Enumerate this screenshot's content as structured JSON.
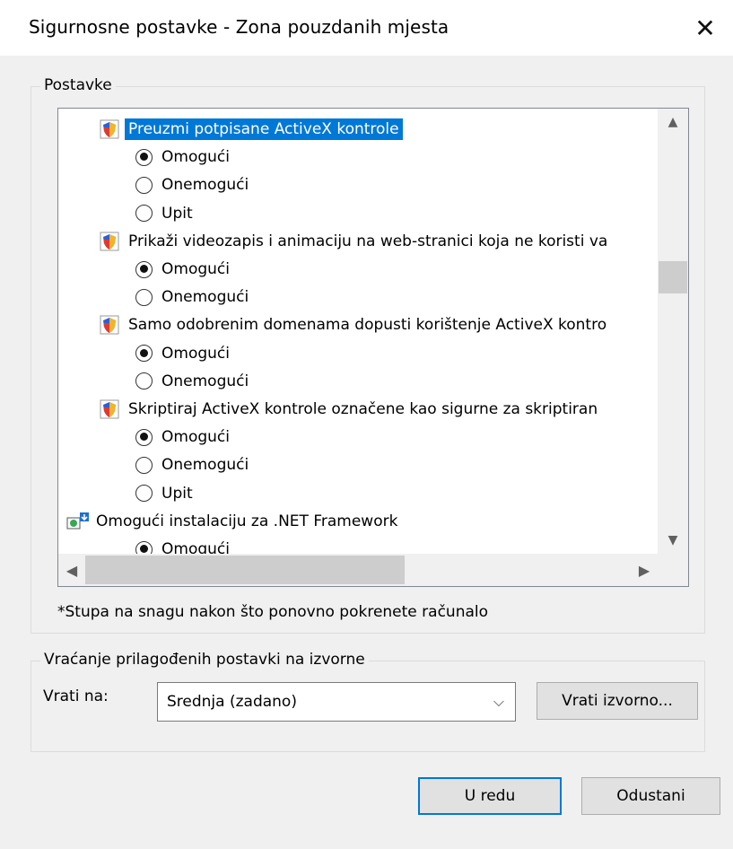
{
  "dialog": {
    "title": "Sigurnosne postavke - Zona pouzdanih mjesta",
    "close_glyph": "✕"
  },
  "settings_group": {
    "legend": "Postavke",
    "items": [
      {
        "type": "category",
        "icon": "shield-icon",
        "label": "Preuzmi potpisane ActiveX kontrole",
        "selected": true
      },
      {
        "type": "option",
        "label": "Omogući",
        "checked": true
      },
      {
        "type": "option",
        "label": "Onemogući",
        "checked": false
      },
      {
        "type": "option",
        "label": "Upit",
        "checked": false
      },
      {
        "type": "category",
        "icon": "shield-icon",
        "label": "Prikaži videozapis i animaciju na web-stranici koja ne koristi va",
        "selected": false
      },
      {
        "type": "option",
        "label": "Omogući",
        "checked": true
      },
      {
        "type": "option",
        "label": "Onemogući",
        "checked": false
      },
      {
        "type": "category",
        "icon": "shield-icon",
        "label": "Samo odobrenim domenama dopusti korištenje ActiveX kontro",
        "selected": false
      },
      {
        "type": "option",
        "label": "Omogući",
        "checked": true
      },
      {
        "type": "option",
        "label": "Onemogući",
        "checked": false
      },
      {
        "type": "category",
        "icon": "shield-icon",
        "label": "Skriptiraj ActiveX kontrole označene kao sigurne za skriptiran",
        "selected": false
      },
      {
        "type": "option",
        "label": "Omogući",
        "checked": true
      },
      {
        "type": "option",
        "label": "Onemogući",
        "checked": false
      },
      {
        "type": "option",
        "label": "Upit",
        "checked": false
      },
      {
        "type": "category-net",
        "icon": "net-framework-icon",
        "label": "Omogući instalaciju za .NET Framework",
        "selected": false
      },
      {
        "type": "option",
        "label": "Omogući",
        "checked": true
      }
    ],
    "footnote": "*Stupa na snagu nakon što ponovno pokrenete računalo"
  },
  "reset_group": {
    "legend": "Vraćanje prilagođenih postavki na izvorne",
    "label": "Vrati na:",
    "selected_level": "Srednja (zadano)",
    "restore_button": "Vrati izvorno..."
  },
  "footer": {
    "ok_label": "U redu",
    "cancel_label": "Odustani"
  },
  "colors": {
    "selection": "#0078d7",
    "dialog_bg": "#f0f0f0"
  }
}
